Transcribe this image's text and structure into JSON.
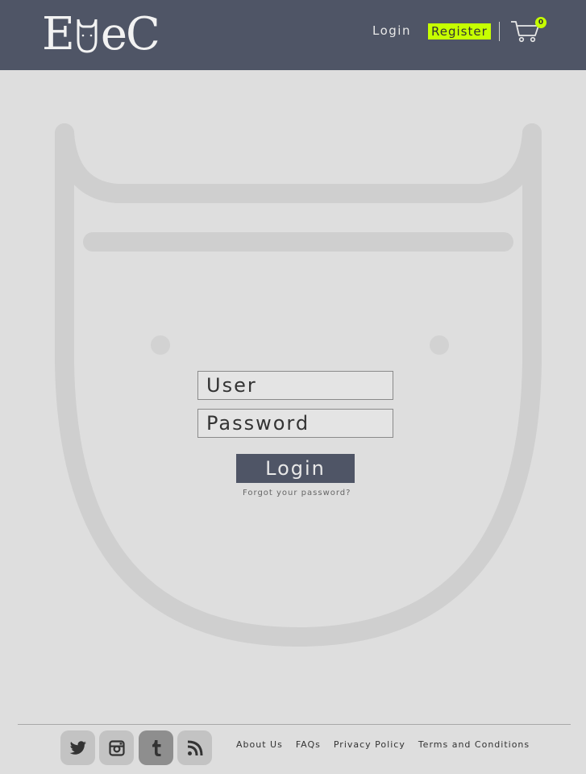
{
  "header": {
    "logo_left": "E",
    "logo_right": "eC",
    "login_label": "Login",
    "register_label": "Register",
    "cart_count": "0",
    "icons": [
      "cart-icon"
    ]
  },
  "form": {
    "user_placeholder": "User",
    "password_placeholder": "Password",
    "login_button": "Login",
    "forgot_link": "Forgot your password?"
  },
  "footer": {
    "social": [
      {
        "name": "twitter-icon"
      },
      {
        "name": "instagram-icon"
      },
      {
        "name": "tumblr-icon"
      },
      {
        "name": "rss-icon"
      }
    ],
    "links": [
      "About Us",
      "FAQs",
      "Privacy Policy",
      "Terms and Conditions"
    ]
  },
  "colors": {
    "header_bg": "#4f5566",
    "accent": "#c6ff00",
    "page_bg": "#dedede"
  }
}
